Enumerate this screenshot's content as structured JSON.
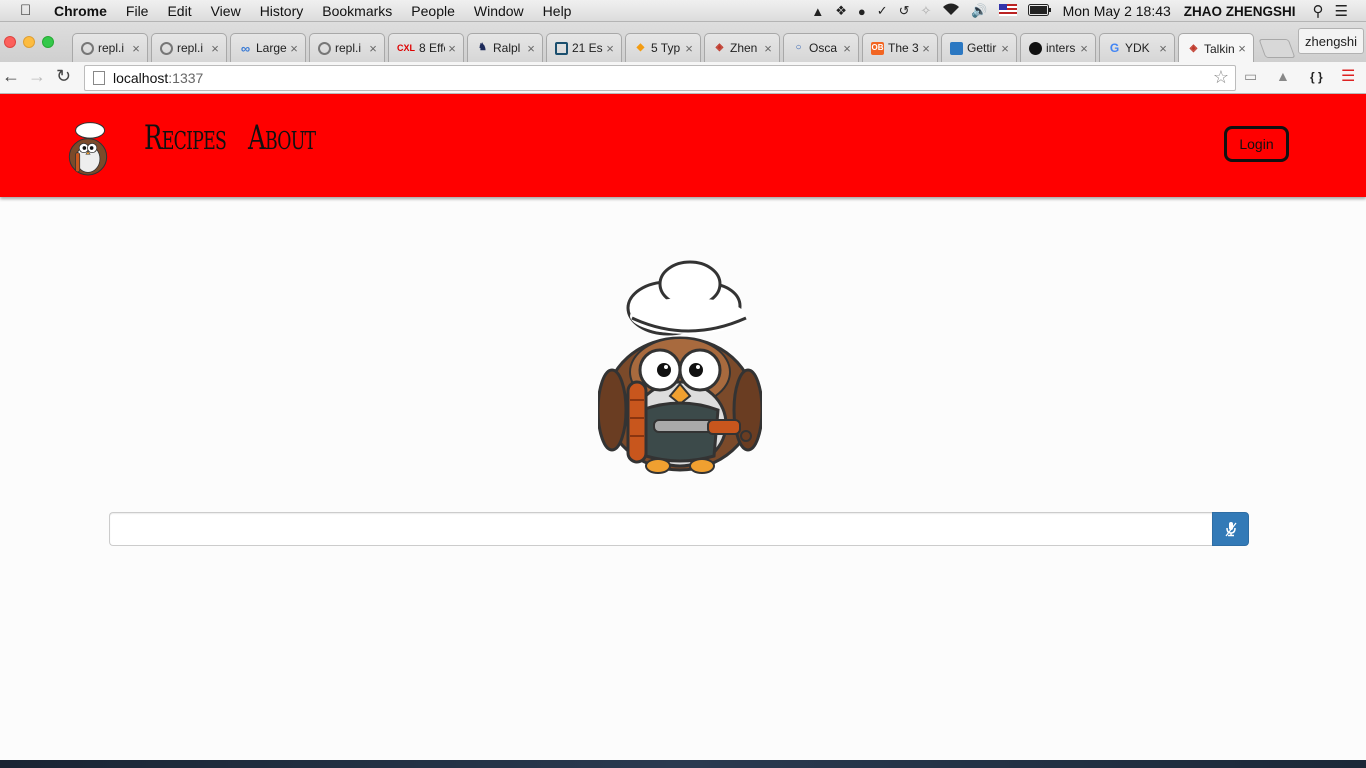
{
  "menubar": {
    "app": "Chrome",
    "items": [
      "File",
      "Edit",
      "View",
      "History",
      "Bookmarks",
      "People",
      "Window",
      "Help"
    ],
    "clock": "Mon May 2  18:43",
    "user": "ZHAO ZHENGSHI"
  },
  "tabs": [
    {
      "title": "repl.i",
      "icon": "repl-icon"
    },
    {
      "title": "repl.i",
      "icon": "repl-icon"
    },
    {
      "title": "Large",
      "icon": "infinity-icon"
    },
    {
      "title": "repl.i",
      "icon": "repl-icon"
    },
    {
      "title": "8 Effe",
      "icon": "cxl-icon",
      "badge": "CXL"
    },
    {
      "title": "Ralpl",
      "icon": "polo-icon"
    },
    {
      "title": "21 Es",
      "icon": "monitor-icon"
    },
    {
      "title": "5 Typ",
      "icon": "diamond-icon"
    },
    {
      "title": "Zhen",
      "icon": "git-icon"
    },
    {
      "title": "Osca",
      "icon": "circle-icon"
    },
    {
      "title": "The 3",
      "icon": "ob-icon",
      "badge": "OB"
    },
    {
      "title": "Gettir",
      "icon": "book-icon"
    },
    {
      "title": "inters",
      "icon": "github-icon"
    },
    {
      "title": "YDK",
      "icon": "google-icon",
      "badge": "G"
    },
    {
      "title": "Talkin",
      "icon": "git-icon"
    }
  ],
  "profile_name": "zhengshi",
  "omnibox": {
    "host": "localhost",
    "port": ":1337"
  },
  "nav": {
    "links": [
      "Recipes",
      "About"
    ],
    "login": "Login"
  },
  "search": {
    "value": "",
    "placeholder": ""
  },
  "colors": {
    "navbar": "#ff0000",
    "button": "#337ab7"
  }
}
